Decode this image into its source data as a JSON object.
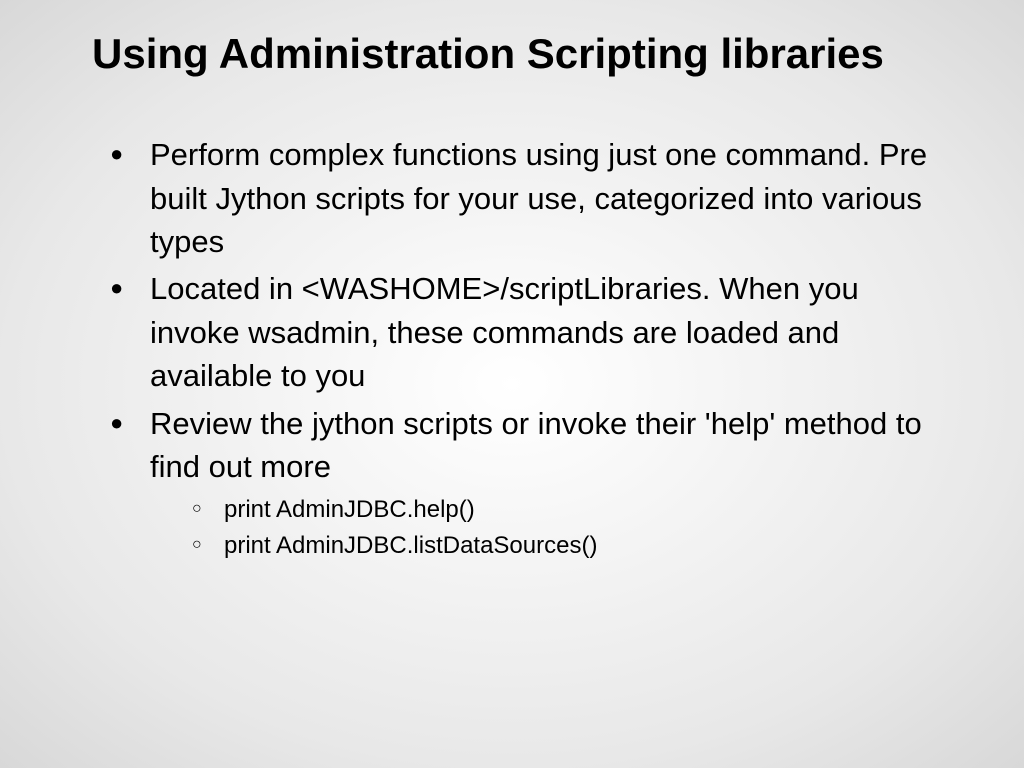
{
  "title": "Using Administration Scripting libraries",
  "bullets": [
    {
      "text": "Perform complex functions using just one command. Pre built Jython scripts for your use, categorized into various types"
    },
    {
      "text": "Located in <WASHOME>/scriptLibraries. When you invoke wsadmin, these commands are loaded and available to you"
    },
    {
      "text": "Review the jython scripts or invoke their 'help' method to find out more",
      "sub": [
        "print AdminJDBC.help()",
        "print AdminJDBC.listDataSources()"
      ]
    }
  ]
}
